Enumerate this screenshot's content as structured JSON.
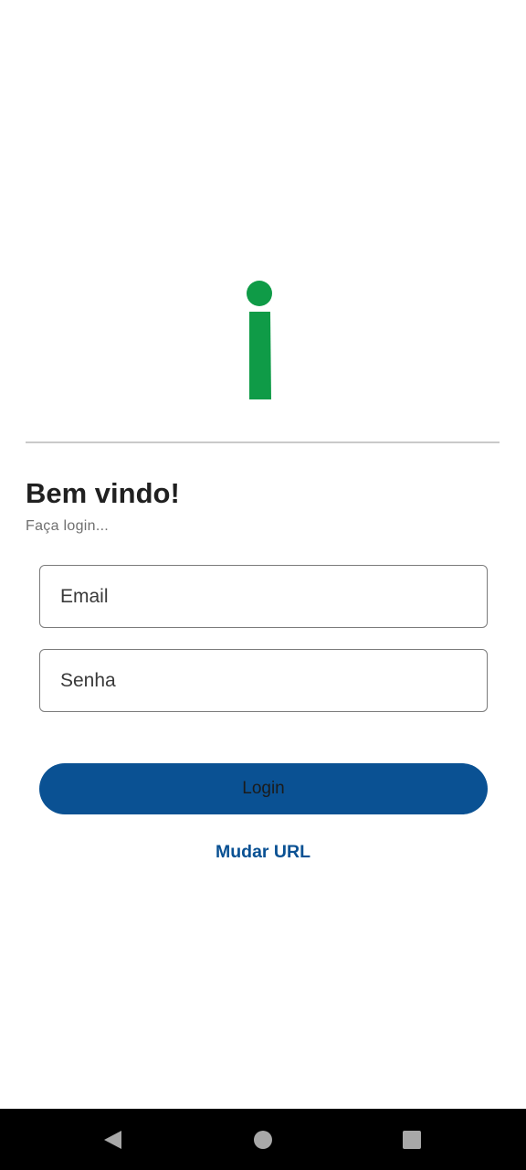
{
  "logo": {
    "icon": "info-i-logo",
    "color": "#0f9b47"
  },
  "welcome": {
    "title": "Bem vindo!",
    "subtitle": "Faça login..."
  },
  "form": {
    "email": {
      "placeholder": "Email",
      "value": ""
    },
    "password": {
      "placeholder": "Senha",
      "value": ""
    },
    "login_label": "Login",
    "change_url_label": "Mudar URL"
  },
  "navigation": {
    "back_icon": "triangle-back-icon",
    "home_icon": "circle-home-icon",
    "recent_icon": "square-recent-apps-icon"
  },
  "colors": {
    "primary": "#0a5193",
    "logo_green": "#0f9b47",
    "navigation_background": "#000000"
  }
}
